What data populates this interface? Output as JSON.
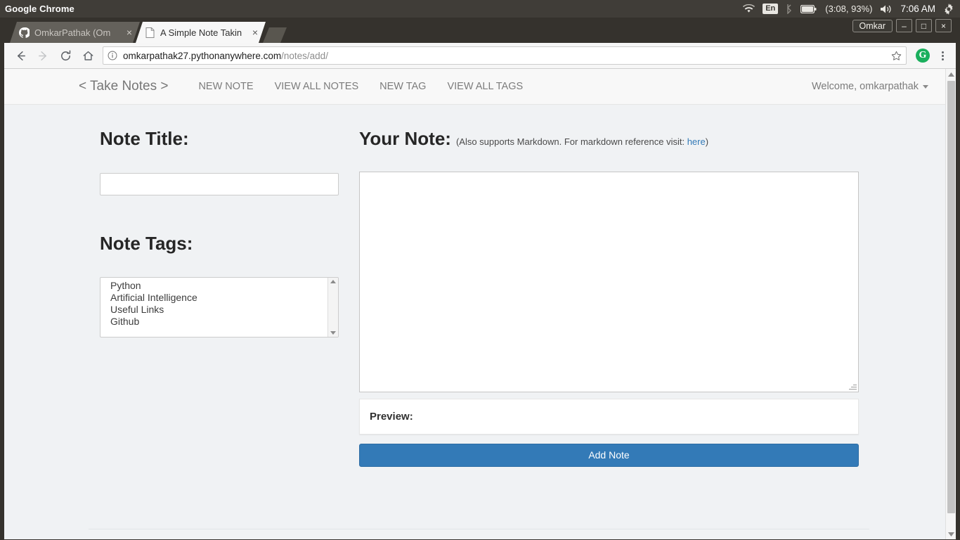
{
  "os_panel": {
    "app_title": "Google Chrome",
    "tray": {
      "wifi_icon": "wifi-icon",
      "keyboard_layout": "En",
      "bluetooth_icon": "bluetooth-icon",
      "battery_icon": "battery-icon",
      "battery_status": "(3:08, 93%)",
      "volume_icon": "volume-icon",
      "clock": "7:06 AM",
      "settings_icon": "gear-icon"
    }
  },
  "browser": {
    "tabs": [
      {
        "title": "OmkarPathak (Om",
        "favicon": "github-icon",
        "active": false,
        "close_icon": "×"
      },
      {
        "title": "A Simple Note Takin",
        "favicon": "document-icon",
        "active": true,
        "close_icon": "×"
      }
    ],
    "new_tab_icon": "plus-icon",
    "window_controls": {
      "user_label": "Omkar",
      "minimize": "–",
      "maximize": "□",
      "close": "×"
    },
    "toolbar": {
      "back_icon": "arrow-left-icon",
      "forward_icon": "arrow-right-icon",
      "reload_icon": "reload-icon",
      "home_icon": "home-icon",
      "info_icon": "page-info-icon",
      "url_host": "omkarpathak27.pythonanywhere.com",
      "url_path": "/notes/add/",
      "bookmark_icon": "star-icon",
      "extension_icon_letter": "G",
      "menu_icon": "kebab-menu-icon"
    }
  },
  "page": {
    "navbar": {
      "brand": "< Take Notes >",
      "links": [
        {
          "label": "NEW NOTE"
        },
        {
          "label": "VIEW ALL NOTES"
        },
        {
          "label": "NEW TAG"
        },
        {
          "label": "VIEW ALL TAGS"
        }
      ],
      "user_menu": "Welcome, omkarpathak"
    },
    "form": {
      "note_title_label": "Note Title:",
      "note_title_value": "",
      "note_title_placeholder": "",
      "note_tags_label": "Note Tags:",
      "note_tags_options": [
        "Python",
        "Artificial Intelligence",
        "Useful Links",
        "Github"
      ],
      "your_note_label": "Your Note:",
      "your_note_hint_pre": "(Also supports Markdown. For markdown reference visit: ",
      "your_note_hint_link": "here",
      "your_note_hint_post": ")",
      "note_body_value": "",
      "preview_label": "Preview:",
      "preview_content": "",
      "submit_label": "Add Note"
    },
    "colors": {
      "primary_button": "#337ab7",
      "link": "#337ab7",
      "page_background": "#f0f2f4",
      "navbar_background": "#f8f8f8"
    }
  }
}
